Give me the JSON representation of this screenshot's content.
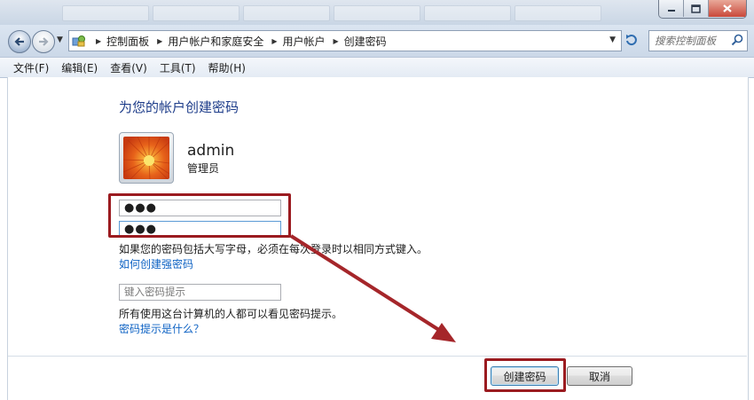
{
  "titlebar": {
    "buttons": [
      {
        "name": "minimize",
        "icon": "minimize-icon"
      },
      {
        "name": "maximize",
        "icon": "maximize-icon"
      },
      {
        "name": "close",
        "icon": "close-icon"
      }
    ]
  },
  "address": {
    "crumbs": [
      "控制面板",
      "用户帐户和家庭安全",
      "用户帐户",
      "创建密码"
    ],
    "location_icon": "control-panel-icon",
    "refresh_icon": "refresh-icon"
  },
  "search": {
    "placeholder": "搜索控制面板",
    "icon": "search-icon"
  },
  "menu": {
    "items": [
      "文件(F)",
      "编辑(E)",
      "查看(V)",
      "工具(T)",
      "帮助(H)"
    ]
  },
  "main": {
    "title": "为您的帐户创建密码",
    "user": {
      "name": "admin",
      "role": "管理员",
      "avatar_icon": "user-avatar-flower"
    },
    "password_mask": "●●●",
    "confirm_mask": "●●●",
    "case_note": "如果您的密码包括大写字母，必须在每次登录时以相同方式键入。",
    "strong_link": "如何创建强密码",
    "hint_placeholder": "键入密码提示",
    "hint_note": "所有使用这台计算机的人都可以看见密码提示。",
    "hint_link": "密码提示是什么？"
  },
  "buttons": {
    "create": "创建密码",
    "cancel": "取消"
  },
  "colors": {
    "highlight": "#9b1b20",
    "title": "#1e3d8a",
    "link": "#0f63c4"
  }
}
